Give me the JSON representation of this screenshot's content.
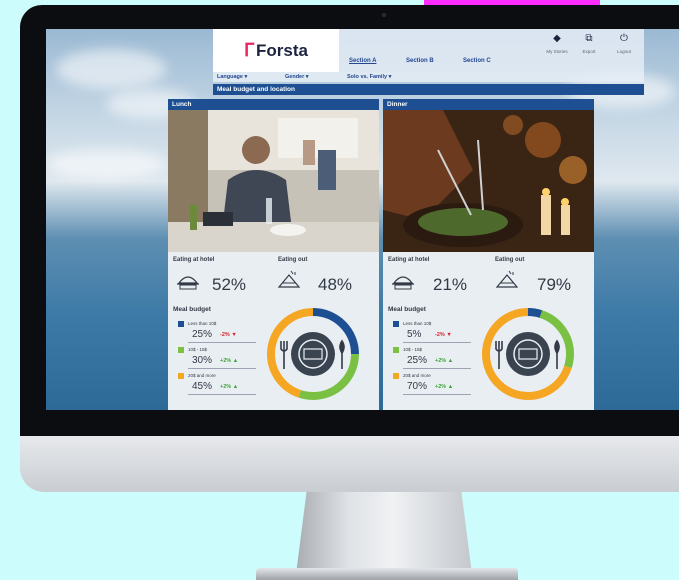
{
  "brand": {
    "mark": "ᒥ",
    "name": "Forsta",
    "mark_color": "#e8265e"
  },
  "nav": {
    "sections": [
      "Section A",
      "Section B",
      "Section C"
    ],
    "utilities": [
      {
        "label": "My Stories",
        "icon": "tag-icon"
      },
      {
        "label": "Export",
        "icon": "export-icon"
      },
      {
        "label": "Logout",
        "icon": "power-icon"
      }
    ],
    "filters": [
      "Language ▾",
      "Gender ▾",
      "Solo vs. Family ▾"
    ]
  },
  "page_title": "Meal budget and location",
  "colors": {
    "navy": "#1d4f92",
    "blue": "#1d4f92",
    "green": "#7ac143",
    "orange": "#f5a623",
    "down": "#d8222b",
    "up": "#3da338"
  },
  "panels": [
    {
      "header": "Lunch",
      "hotel_label": "Eating at hotel",
      "hotel_pct": "52%",
      "out_label": "Eating out",
      "out_pct": "48%",
      "budget_title": "Meal budget",
      "budget": [
        {
          "name": "Less than 10$",
          "pct": "25%",
          "chg": "-2%",
          "dir": "down",
          "value": 25,
          "color": "#1d4f92"
        },
        {
          "name": "10$ - 15$",
          "pct": "30%",
          "chg": "+2%",
          "dir": "up",
          "value": 30,
          "color": "#7ac143"
        },
        {
          "name": "20$ and more",
          "pct": "45%",
          "chg": "+2%",
          "dir": "up",
          "value": 45,
          "color": "#f5a623"
        }
      ]
    },
    {
      "header": "Dinner",
      "hotel_label": "Eating at hotel",
      "hotel_pct": "21%",
      "out_label": "Eating out",
      "out_pct": "79%",
      "budget_title": "Meal budget",
      "budget": [
        {
          "name": "Less than 10$",
          "pct": "5%",
          "chg": "-2%",
          "dir": "down",
          "value": 5,
          "color": "#1d4f92"
        },
        {
          "name": "10$ - 15$",
          "pct": "25%",
          "chg": "+2%",
          "dir": "up",
          "value": 25,
          "color": "#7ac143"
        },
        {
          "name": "20$ and more",
          "pct": "70%",
          "chg": "+2%",
          "dir": "up",
          "value": 70,
          "color": "#f5a623"
        }
      ]
    }
  ],
  "arrows": {
    "down": "▼",
    "up": "▲"
  }
}
